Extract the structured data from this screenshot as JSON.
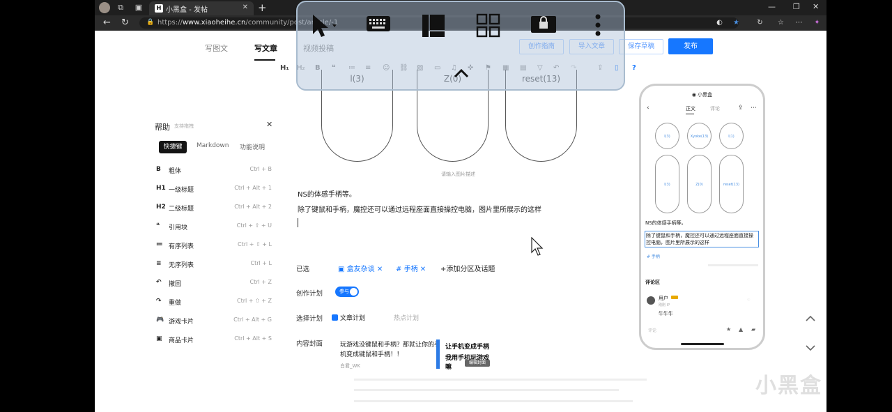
{
  "browser": {
    "tab_title": "小黑盒 - 发帖",
    "tab_favicon": "H",
    "url_prefix": "https://",
    "url_domain": "www.xiaoheihe.cn",
    "url_path": "/community/post/article/-1"
  },
  "topnav": {
    "tabs": [
      "写图文",
      "写文章",
      "视频投稿"
    ],
    "active_tab": "写文章",
    "buttons": {
      "guide": "创作指南",
      "import": "导入文章",
      "save_draft": "保存草稿",
      "publish": "发布"
    }
  },
  "toolbar": {
    "items": [
      "H1",
      "H2",
      "B",
      "quote",
      "ordered-list",
      "unordered-list",
      "emoji",
      "link",
      "image",
      "video",
      "music",
      "game-card",
      "product-card",
      "table",
      "divider",
      "fold",
      "undo",
      "redo",
      "upload",
      "mobile-preview",
      "help"
    ],
    "help_glyph": "?"
  },
  "overlay": {
    "icons": [
      "cursor-icon",
      "keyboard-icon",
      "layout-icon",
      "grid-icon",
      "lock-icon",
      "more-icon"
    ],
    "collapse": "chevron-up"
  },
  "editor": {
    "bubble_labels": [
      "l(3)",
      "Z(0)",
      "reset(13)"
    ],
    "image_caption": "请输入图片描述",
    "paragraph1": "NS的体感手柄等。",
    "paragraph2": "除了键鼠和手柄，魔控还可以通过远程座面直接操控电脑，图片里所展示的这样"
  },
  "help": {
    "title": "帮助",
    "subtitle": "支持拖拽",
    "tabs": [
      "快捷键",
      "Markdown",
      "功能说明"
    ],
    "shortcuts": [
      {
        "icon": "B",
        "label": "粗体",
        "keys": "Ctrl  +  B"
      },
      {
        "icon": "H1",
        "label": "一级标题",
        "keys": "Ctrl  +  Alt  +  1"
      },
      {
        "icon": "H2",
        "label": "二级标题",
        "keys": "Ctrl  +  Alt  +  2"
      },
      {
        "icon": "❝",
        "label": "引用块",
        "keys": "Ctrl  +  ⇧  +  U"
      },
      {
        "icon": "≔",
        "label": "有序列表",
        "keys": "Ctrl  +  ⇧  +  L"
      },
      {
        "icon": "≡",
        "label": "无序列表",
        "keys": "Ctrl  +  L"
      },
      {
        "icon": "↶",
        "label": "撤回",
        "keys": "Ctrl  +  Z"
      },
      {
        "icon": "↷",
        "label": "重做",
        "keys": "Ctrl  +  ⇧  +  Z"
      },
      {
        "icon": "🎮",
        "label": "游戏卡片",
        "keys": "Ctrl  +  Alt  +  G"
      },
      {
        "icon": "▣",
        "label": "商品卡片",
        "keys": "Ctrl  +  Alt  +  S"
      }
    ]
  },
  "meta": {
    "selected_label": "已选",
    "tags": [
      {
        "prefix": "▣",
        "text": "盒友杂谈"
      },
      {
        "prefix": "#",
        "text": "手柄"
      }
    ],
    "add_tag": "添加分区及话题",
    "plan_label": "创作计划",
    "plan_toggle": "参与",
    "choose_label": "选择计划",
    "plan_options": [
      "文章计划",
      "热点计划"
    ],
    "cover_label": "内容封面",
    "cover_title_1": "玩游戏没键鼠和手柄？那就让你的手",
    "cover_title_2": "机变成键鼠和手柄！！",
    "cover_author": "白君_WK",
    "cover_image_line1": "让手机变成手柄",
    "cover_image_line2": "我用手机玩游戏嘛",
    "cover_image_badge": "编辑封面"
  },
  "phone": {
    "title": "小黑盒",
    "tabs": [
      "正文",
      "评论"
    ],
    "circles": [
      "l(3)",
      "Xyoke(13)",
      "l(1)"
    ],
    "pills": [
      "l(3)",
      "Z(0)",
      "reset(13)"
    ],
    "text1": "NS的体感手柄等。",
    "text2": "除了键鼠和手柄，魔控还可以通过远程座面直接操控电脑，图片里所展示的这样",
    "tag": "# 手柄",
    "comment_section": "评论区",
    "user": "用户",
    "date": "刚刚 IP",
    "comment": "牛牛牛",
    "input_placeholder": "评论"
  },
  "watermark": "小黑盒",
  "colors": {
    "accent": "#1677ff",
    "tag": "#1677ff"
  }
}
